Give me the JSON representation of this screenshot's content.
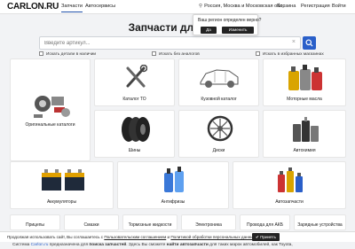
{
  "header": {
    "logo": "CARLON.RU",
    "nav": [
      "Запчасти",
      "Автосервисы"
    ],
    "region": "Россия, Москва и Московская обл.",
    "cart": "Корзина",
    "register": "Регистрация",
    "login": "Войти"
  },
  "region_popup": {
    "question": "Ваш регион определен верно?",
    "yes": "Да",
    "change": "Изменить"
  },
  "page_title": "Запчасти для авто",
  "search": {
    "placeholder": "Введите артикул...",
    "clear_glyph": "×"
  },
  "search_options": [
    "Искать детали в наличии",
    "Искать без аналогов",
    "Искать в избранных магазинах"
  ],
  "categories_row1": [
    "Оригинальные каталоги",
    "Каталог ТО",
    "Кузовной каталог",
    "Моторные масла"
  ],
  "categories_row2": [
    "Шины",
    "Диски",
    "Автохимия"
  ],
  "categories_row3": [
    "Аккумуляторы",
    "Антифризы",
    "Автозапчасти"
  ],
  "categories_row4": [
    "Прицепы",
    "Смазки",
    "Тормозные жидкости",
    "Электроника",
    "Провода для АКБ",
    "Зарядные устройства"
  ],
  "cookie": {
    "text_before": "Продолжая использовать сайт, Вы соглашаетесь с",
    "link1": "Пользовательским соглашением",
    "mid": "и",
    "link2": "Политикой обработки персональных данных",
    "accept": "Принять",
    "check": "✔"
  },
  "footer": {
    "text1": "Система",
    "link": "Carlon.ru",
    "text2": "предназначена для",
    "bold1": "поиска запчастей",
    "text3": ". Здесь Вы сможете",
    "bold2": "найти автозапчасти",
    "text4": "для таких марок автомобилей, как Toyota,"
  },
  "colors": {
    "accent": "#2a5fc9",
    "dark_button": "#232323",
    "page_bg": "#f2f3f5"
  }
}
